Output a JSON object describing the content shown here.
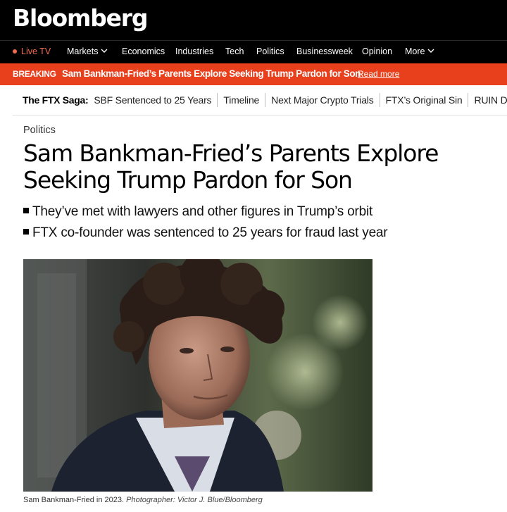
{
  "brand": {
    "logo": "Bloomberg"
  },
  "nav": {
    "live": "Live TV",
    "items": [
      "Markets",
      "Economics",
      "Industries",
      "Tech",
      "Politics",
      "Businessweek",
      "Opinion",
      "More"
    ]
  },
  "breaking": {
    "tag": "BREAKING",
    "headline": "Sam Bankman-Fried’s Parents Explore Seeking Trump Pardon for Son",
    "link": "Read more"
  },
  "saga": {
    "title": "The FTX Saga:",
    "links": [
      "SBF Sentenced to 25 Years",
      "Timeline",
      "Next Major Crypto Trials",
      "FTX’s Original Sin",
      "RUIN Documentary"
    ]
  },
  "article": {
    "kicker": "Politics",
    "headline": "Sam Bankman-Fried’s Parents Explore Seeking Trump Pardon for Son",
    "bullets": [
      "They’ve met with lawyers and other figures in Trump’s orbit",
      "FTX co-founder was sentenced to 25 years for fraud last year"
    ],
    "caption_text": "Sam Bankman-Fried in 2023.",
    "caption_credit": "Photographer: Victor J. Blue/Bloomberg"
  },
  "colors": {
    "breaking": "#e8401c",
    "live": "#f26b4d",
    "bar": "#000000"
  },
  "icons": [
    "live-dot-icon",
    "chevron-down-icon"
  ]
}
